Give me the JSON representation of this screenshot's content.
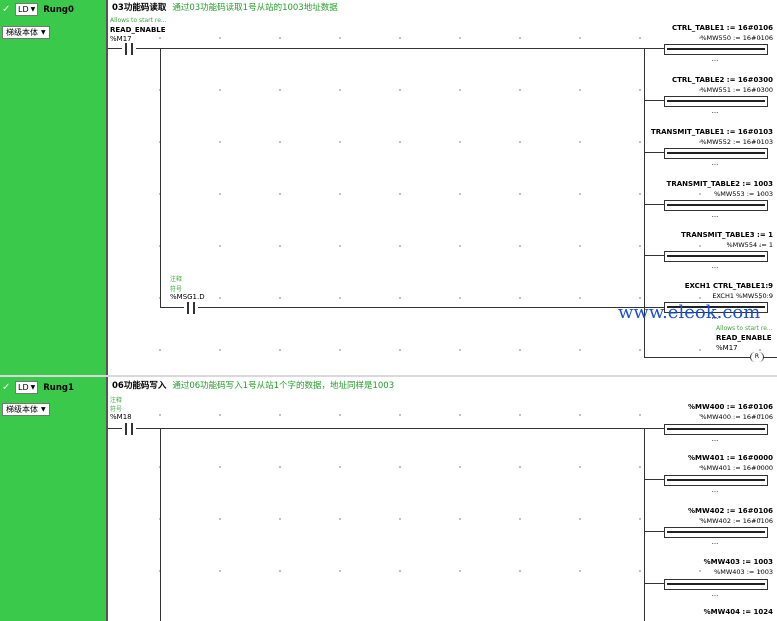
{
  "rung0": {
    "enabled_icon": "check-icon",
    "language": "LD",
    "name": "Rung0",
    "ladder_label": "梯级本体",
    "title": "03功能码读取",
    "comment": "通过03功能码读取1号从站的1003地址数据",
    "contact1": {
      "note": "Allows to start re...",
      "name": "READ_ENABLE",
      "addr": "%M17"
    },
    "contact2": {
      "note1": "注释",
      "note2": "符号",
      "addr": "%MSG1.D"
    },
    "ops": [
      {
        "label": "CTRL_TABLE1 := 16#0106",
        "sub": "%MW550 := 16#0106"
      },
      {
        "label": "CTRL_TABLE2 := 16#0300",
        "sub": "%MW551 := 16#0300"
      },
      {
        "label": "TRANSMIT_TABLE1 := 16#0103",
        "sub": "%MW552 := 16#0103"
      },
      {
        "label": "TRANSMIT_TABLE2 := 1003",
        "sub": "%MW553 := 1003"
      },
      {
        "label": "TRANSMIT_TABLE3 := 1",
        "sub": "%MW554 := 1"
      },
      {
        "label": "EXCH1 CTRL_TABLE1:9",
        "sub": "EXCH1 %MW550:9"
      }
    ],
    "ellipsis": "...",
    "coil": {
      "note": "Allows to start re...",
      "name": "READ_ENABLE",
      "addr": "%M17",
      "type": "R"
    }
  },
  "rung1": {
    "enabled_icon": "check-icon",
    "language": "LD",
    "name": "Rung1",
    "ladder_label": "梯级本体",
    "title": "06功能码写入",
    "comment": "通过06功能码写入1号从站1个字的数据，地址同样是1003",
    "contact1": {
      "note1": "注释",
      "note2": "符号",
      "addr": "%M18"
    },
    "ops": [
      {
        "label": "%MW400 := 16#0106",
        "sub": "%MW400 := 16#0106"
      },
      {
        "label": "%MW401 := 16#0000",
        "sub": "%MW401 := 16#0000"
      },
      {
        "label": "%MW402 := 16#0106",
        "sub": "%MW402 := 16#0106"
      },
      {
        "label": "%MW403 := 1003",
        "sub": "%MW403 := 1003"
      },
      {
        "label": "%MW404 := 1024",
        "sub": ""
      }
    ],
    "ellipsis": "..."
  },
  "watermark": "www.eleok.com"
}
